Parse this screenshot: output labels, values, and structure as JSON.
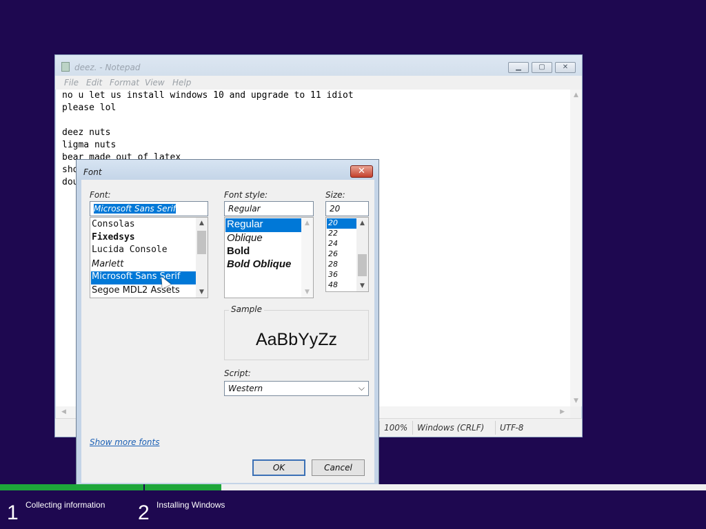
{
  "notepad": {
    "title": "deez. - Notepad",
    "menu": [
      "File",
      "Edit",
      "Format",
      "View",
      "Help"
    ],
    "lines": [
      "no u let us install windows 10 and upgrade to 11 idiot",
      "please lol",
      "",
      "deez nuts",
      "ligma nuts",
      "bear made out of latex",
      "sho",
      "dou"
    ],
    "status": {
      "zoom": "100%",
      "line_ending": "Windows (CRLF)",
      "encoding": "UTF-8"
    }
  },
  "font_dialog": {
    "title": "Font",
    "font_label": "Font:",
    "font_value": "Microsoft Sans Serif",
    "fonts": [
      "Consolas",
      "Fixedsys",
      "Lucida Console",
      "Marlett",
      "Microsoft Sans Serif",
      "Segoe MDL2 Assets"
    ],
    "style_label": "Font style:",
    "style_value": "Regular",
    "styles": [
      "Regular",
      "Oblique",
      "Bold",
      "Bold Oblique"
    ],
    "size_label": "Size:",
    "size_value": "20",
    "sizes": [
      "20",
      "22",
      "24",
      "26",
      "28",
      "36",
      "48"
    ],
    "sample_label": "Sample",
    "sample_text": "AaBbYyZz",
    "script_label": "Script:",
    "script_value": "Western",
    "show_more": "Show more fonts",
    "ok": "OK",
    "cancel": "Cancel"
  },
  "setup": {
    "steps": [
      {
        "number": "1",
        "label": "Collecting information"
      },
      {
        "number": "2",
        "label": "Installing Windows"
      }
    ],
    "accent_color": "#1ea63a",
    "background_color": "#1e0850"
  }
}
